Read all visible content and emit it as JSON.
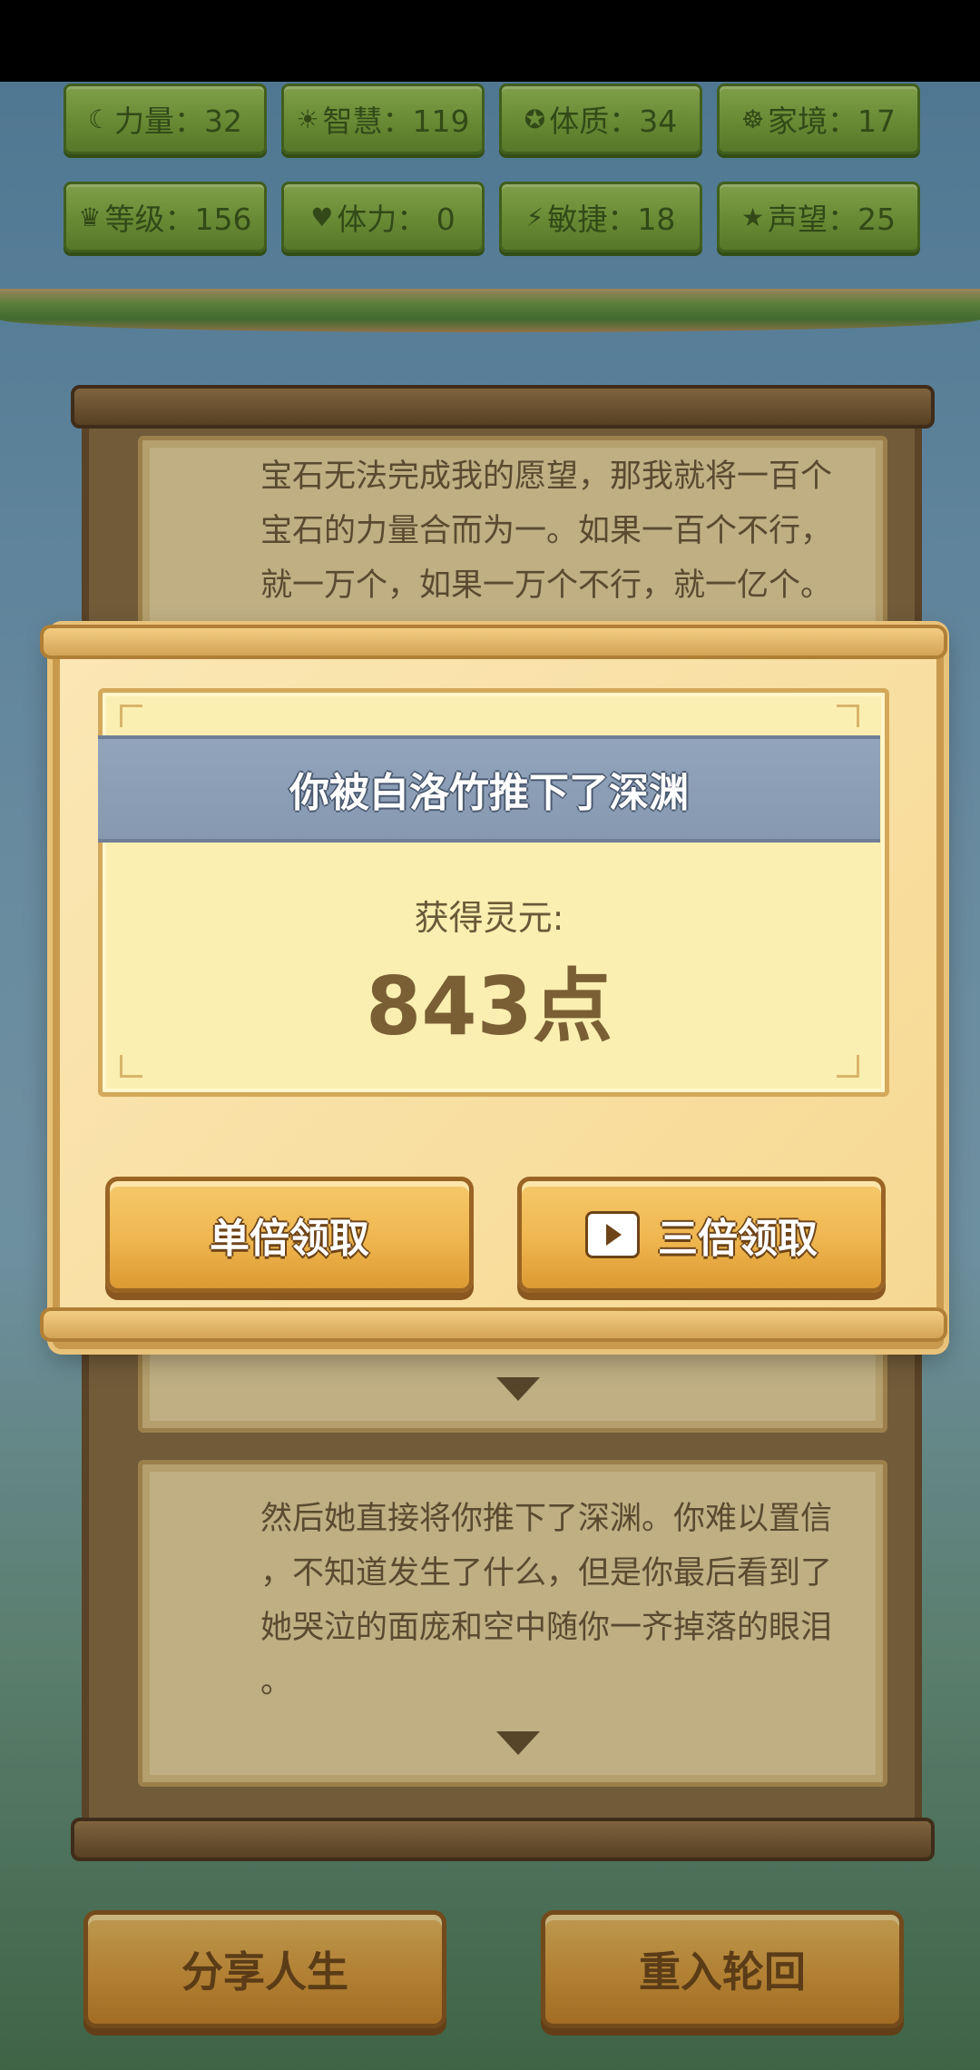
{
  "stats": [
    {
      "icon": "☾",
      "label": "力量：32"
    },
    {
      "icon": "☀",
      "label": "智慧：119"
    },
    {
      "icon": "✪",
      "label": "体质：34"
    },
    {
      "icon": "☸",
      "label": "家境：17"
    },
    {
      "icon": "♛",
      "label": "等级：156"
    },
    {
      "icon": "♥",
      "label": "体力： 0"
    },
    {
      "icon": "⚡",
      "label": "敏捷：18"
    },
    {
      "icon": "★",
      "label": "声望：25"
    }
  ],
  "story": {
    "card1_text": "宝石无法完成我的愿望，那我就将一百个\n宝石的力量合而为一。如果一百个不行，\n就一万个，如果一万个不行，就一亿个。",
    "card2_text": "然后她直接将你推下了深渊。你难以置信\n，不知道发生了什么，但是你最后看到了\n她哭泣的面庞和空中随你一齐掉落的眼泪\n。"
  },
  "modal": {
    "title": "你被白洛竹推下了深渊",
    "gain_label": "获得灵元:",
    "gain_value": "843点",
    "single_button": "单倍领取",
    "triple_button": "三倍领取"
  },
  "bottom": {
    "share_label": "分享人生",
    "restart_label": "重入轮回"
  }
}
